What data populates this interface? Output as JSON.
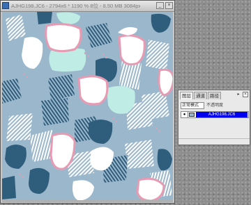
{
  "document_window": {
    "title": "AJHG198.JC6 - 2794x6 * 1190 % 8位 - 8.50 MB 3084px 1/1 20.0%",
    "buttons": {
      "minimize": "_",
      "close": "×"
    },
    "icons": {
      "app": "photoshop-doc-icon"
    },
    "colors": {
      "background": "#9bb7cc",
      "white_shape": "#ffffff",
      "navy_shape": "#2f5d7c",
      "mint_shape": "#bfece4",
      "pink_outline": "#e79bb3"
    }
  },
  "layers_panel": {
    "tabs": [
      "图层",
      "通道",
      "路径"
    ],
    "active_tab": "图层",
    "menu_glyph": "▸",
    "close_glyph": "×",
    "blend_mode": "正常模式",
    "opacity_label": "不透明度",
    "layer": {
      "visible_glyph": "●",
      "name": "AJHG198.JC6"
    }
  }
}
